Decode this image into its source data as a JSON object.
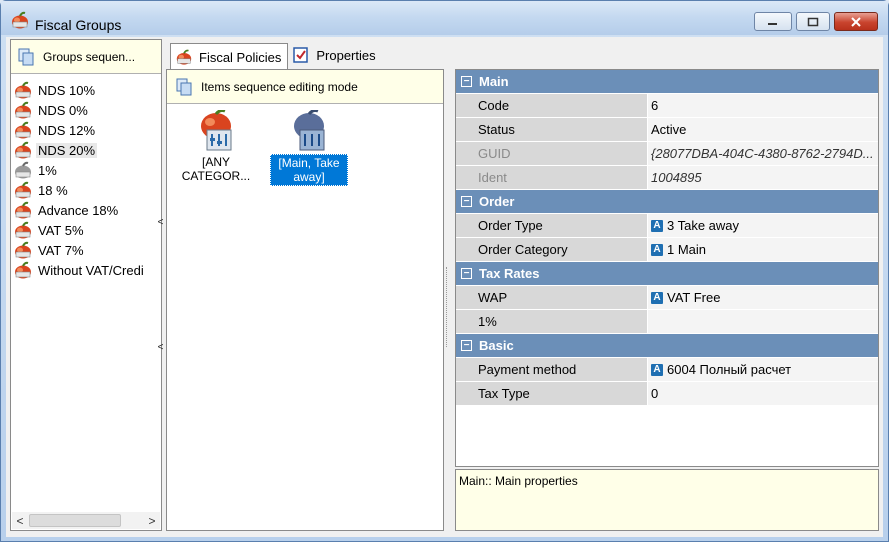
{
  "window": {
    "title": "Fiscal Groups"
  },
  "left_panel": {
    "header_label": "Groups sequen...",
    "items": [
      {
        "label": "NDS 10%",
        "selected": false
      },
      {
        "label": "NDS 0%",
        "selected": false
      },
      {
        "label": "NDS 12%",
        "selected": false
      },
      {
        "label": "NDS 20%",
        "selected": true
      },
      {
        "label": "1%",
        "selected": false
      },
      {
        "label": "18 %",
        "selected": false
      },
      {
        "label": "Advance 18%",
        "selected": false
      },
      {
        "label": "VAT 5%",
        "selected": false
      },
      {
        "label": "VAT 7%",
        "selected": false
      },
      {
        "label": "Without VAT/Credi",
        "selected": false
      }
    ],
    "scroll_left": "<",
    "scroll_right": ">"
  },
  "splitter": {
    "arrow": "<"
  },
  "tabs": [
    {
      "label": "Fiscal Policies",
      "active": true
    },
    {
      "label": "Properties",
      "active": false
    }
  ],
  "middle_panel": {
    "header_label": "Items sequence editing mode",
    "policies": [
      {
        "line1": "[ANY",
        "line2": "CATEGOR...",
        "selected": false
      },
      {
        "line1": "[Main, Take",
        "line2": "away]",
        "selected": true
      }
    ]
  },
  "property_grid": {
    "categories": [
      {
        "name": "Main",
        "rows": [
          {
            "name": "Code",
            "value": "6",
            "readonly": false,
            "badge": false
          },
          {
            "name": "Status",
            "value": "Active",
            "readonly": false,
            "badge": false
          },
          {
            "name": "GUID",
            "value": "{28077DBA-404C-4380-8762-2794D...",
            "readonly": true,
            "badge": false
          },
          {
            "name": "Ident",
            "value": "1004895",
            "readonly": true,
            "badge": false
          }
        ]
      },
      {
        "name": "Order",
        "rows": [
          {
            "name": "Order Type",
            "value": "3 Take away",
            "readonly": false,
            "badge": true
          },
          {
            "name": "Order Category",
            "value": "1 Main",
            "readonly": false,
            "badge": true
          }
        ]
      },
      {
        "name": "Tax Rates",
        "rows": [
          {
            "name": "WAP",
            "value": "VAT Free",
            "readonly": false,
            "badge": true
          },
          {
            "name": "1%",
            "value": "",
            "readonly": false,
            "badge": false
          }
        ]
      },
      {
        "name": "Basic",
        "rows": [
          {
            "name": "Payment method",
            "value": "6004 Полный расчет",
            "readonly": false,
            "badge": true
          },
          {
            "name": "Tax Type",
            "value": "0",
            "readonly": false,
            "badge": false
          }
        ]
      }
    ],
    "collapse_symbol": "−",
    "badge_letter": "A"
  },
  "description": {
    "text": "Main:: Main properties"
  },
  "colors": {
    "category_bar": "#6b8fb8",
    "selection": "#0078d7",
    "info_background": "#ffffe8"
  }
}
